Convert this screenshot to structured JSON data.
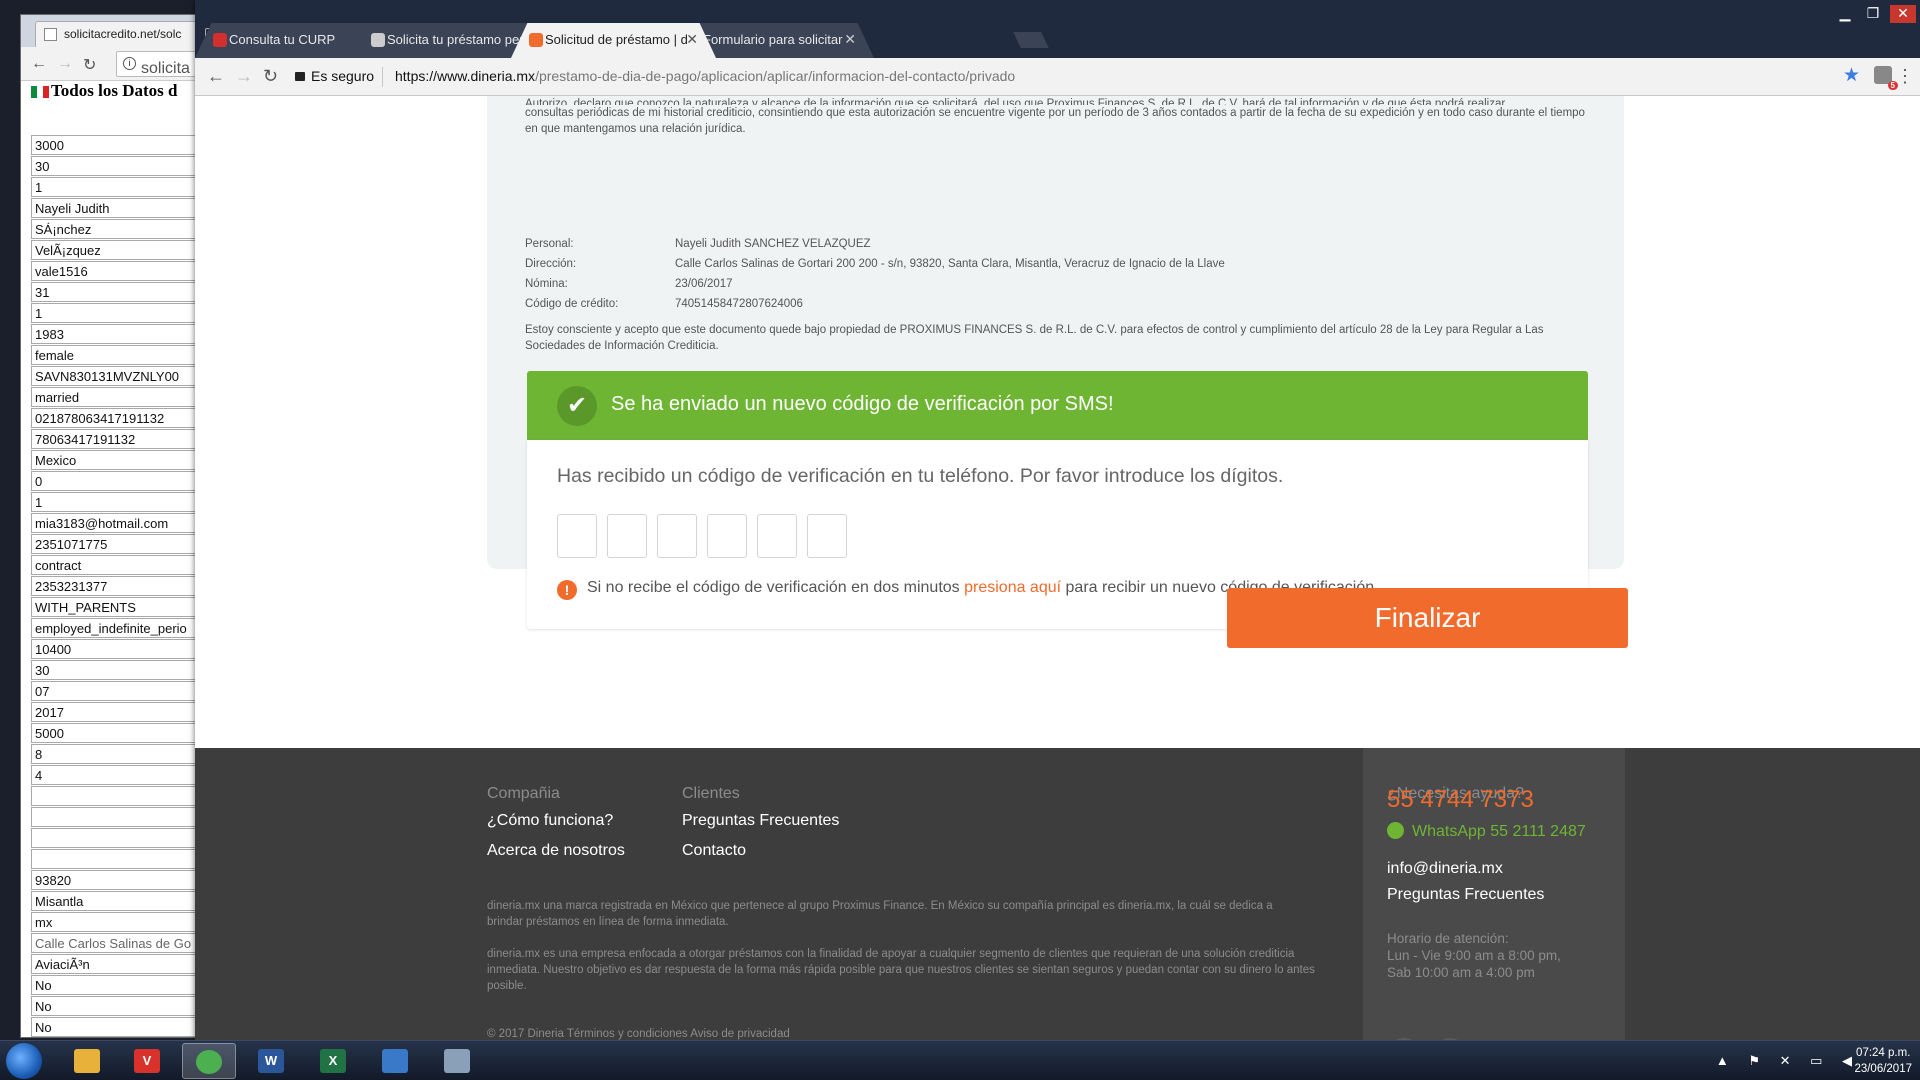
{
  "background_window": {
    "tab_title": "solicitacredito.net/solc",
    "url": "solicita",
    "page_heading": "Todos los Datos d",
    "fields": [
      "3000",
      "30",
      "1",
      "Nayeli Judith",
      "SÁ¡nchez",
      "VelÃ¡zquez",
      "vale1516",
      "31",
      "1",
      "1983",
      "female",
      "SAVN830131MVZNLY00",
      "married",
      "021878063417191132",
      "78063417191132",
      "Mexico",
      "0",
      "1",
      "mia3183@hotmail.com",
      "2351071775",
      "contract",
      "2353231377",
      "WITH_PARENTS",
      "employed_indefinite_perio",
      "10400",
      "30",
      "07",
      "2017",
      "5000",
      "8",
      "4",
      "",
      "",
      "",
      "",
      "93820",
      "Misantla",
      "mx",
      "Calle Carlos Salinas de Go",
      "AviaciÃ³n",
      "No",
      "No",
      "No"
    ]
  },
  "browser": {
    "tabs": [
      {
        "label": "Consulta tu CURP",
        "color": "#d32f2f"
      },
      {
        "label": "Solicita tu préstamo pers",
        "color": "#cccccc"
      },
      {
        "label": "Solicitud de préstamo | d",
        "color": "#f06b2c"
      },
      {
        "label": "Formulario para solicitar",
        "color": "#2f7de0"
      }
    ],
    "active_tab": 2,
    "secure_label": "Es seguro",
    "url_scheme": "https://",
    "url_host": "www.dineria.mx",
    "url_path": "/prestamo-de-dia-de-pago/aplicacion/aplicar/informacion-del-contacto/privado",
    "extension_badge": "5"
  },
  "authorization": {
    "intro_clipped": "Autorizo, declaro que conozco la naturaleza y alcance de la información que se solicitará, del uso que Proximus Finances S. de R.L. de C.V. hará de tal información y de que ésta podrá realizar",
    "intro": "consultas periódicas de mi historial crediticio, consintiendo que esta autorización se encuentre vigente por un período de 3 años contados a partir de la fecha de su expedición y en todo caso durante el tiempo en que mantengamos una relación jurídica.",
    "rows": [
      {
        "label": "Personal:",
        "value": "Nayeli Judith SANCHEZ VELAZQUEZ"
      },
      {
        "label": "Dirección:",
        "value": "Calle Carlos Salinas de Gortari 200 200 - s/n, 93820, Santa Clara, Misantla, Veracruz de Ignacio de la Llave"
      },
      {
        "label": "Nómina:",
        "value": "23/06/2017"
      },
      {
        "label": "Código de crédito:",
        "value": "74051458472807624006"
      }
    ],
    "consent": "Estoy consciente y acepto que este documento quede bajo propiedad de PROXIMUS FINANCES S. de R.L. de C.V. para efectos de control y cumplimiento del artículo 28 de la Ley para Regular a Las Sociedades de Información Crediticia."
  },
  "verification": {
    "banner": "Se ha enviado un nuevo código de verificación por SMS!",
    "prompt": "Has recibido un código de verificación en tu teléfono. Por favor introduce los dígitos.",
    "digits": [
      "",
      "",
      "",
      "",
      "",
      ""
    ],
    "resend_before": "Si no recibe el código de verificación en dos minutos",
    "resend_link": "presiona aquí",
    "resend_after": "para recibir un nuevo código de verificación"
  },
  "submit_label": "Finalizar",
  "footer": {
    "company_heading": "Compañia",
    "company_links": [
      "¿Cómo funciona?",
      "Acerca de nosotros"
    ],
    "clients_heading": "Clientes",
    "clients_links": [
      "Preguntas Frecuentes",
      "Contacto"
    ],
    "para1": "dineria.mx una marca registrada en México que pertenece al grupo Proximus Finance. En México su compañía principal es dineria.mx, la cuál se dedica a brindar préstamos en línea de forma inmediata.",
    "para2": "dineria.mx es una empresa enfocada a otorgar préstamos con la finalidad de apoyar a cualquier segmento de clientes que requieran de una solución crediticia inmediata. Nuestro objetivo es dar respuesta de la forma más rápida posible para que nuestros clientes se sientan seguros y puedan contar con su dinero lo antes posible.",
    "copyright": "© 2017 Dineria     Términos y condiciones   Aviso de privacidad",
    "help_heading": "¿Necesitas ayuda?",
    "phone": "55 4744 7373",
    "whatsapp": "WhatsApp 55 2111 2487",
    "email": "info@dineria.mx",
    "faq": "Preguntas Frecuentes",
    "hours_label": "Horario de atención:",
    "hours_weekday": "Lun - Vie 9:00 am a 8:00 pm,",
    "hours_sat": "Sab 10:00 am a 4:00 pm"
  },
  "taskbar": {
    "apps": [
      {
        "name": "explorer",
        "glyph": "",
        "color": "#e8b23a"
      },
      {
        "name": "vivaldi",
        "glyph": "V",
        "color": "#d9322b"
      },
      {
        "name": "chrome",
        "glyph": "",
        "color": "#4caf50"
      },
      {
        "name": "word",
        "glyph": "W",
        "color": "#2b579a"
      },
      {
        "name": "excel",
        "glyph": "X",
        "color": "#217346"
      },
      {
        "name": "media",
        "glyph": "",
        "color": "#3a78c8"
      },
      {
        "name": "paint",
        "glyph": "",
        "color": "#8aa0b8"
      }
    ],
    "active_app": 2,
    "time": "07:24 p.m.",
    "date": "23/06/2017"
  }
}
